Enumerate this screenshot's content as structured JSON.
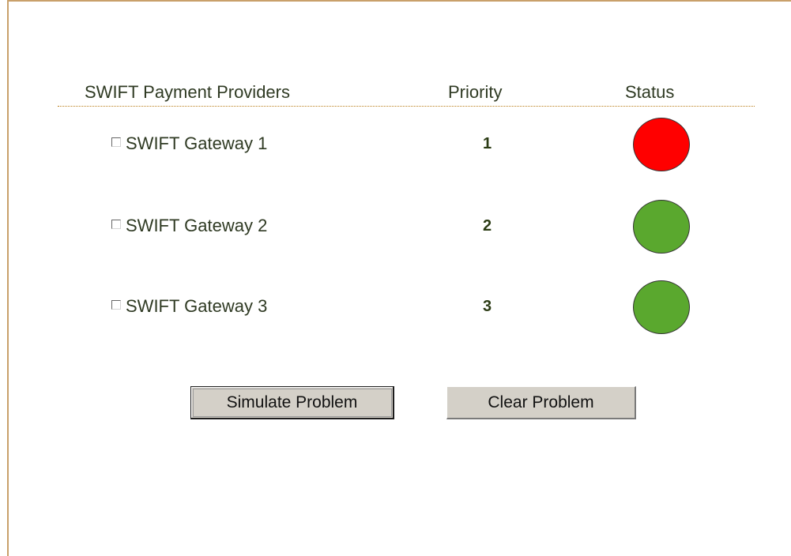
{
  "table": {
    "headers": {
      "provider": "SWIFT Payment Providers",
      "priority": "Priority",
      "status": "Status"
    },
    "rows": [
      {
        "name": "SWIFT Gateway 1",
        "priority": "1",
        "status_color": "#ff0000",
        "checked": false
      },
      {
        "name": "SWIFT Gateway 2",
        "priority": "2",
        "status_color": "#5aa82e",
        "checked": false
      },
      {
        "name": "SWIFT Gateway 3",
        "priority": "3",
        "status_color": "#5aa82e",
        "checked": false
      }
    ]
  },
  "actions": {
    "simulate": "Simulate Problem",
    "clear": "Clear Problem"
  },
  "colors": {
    "border": "#c9a06a",
    "divider": "#b97d18",
    "text": "#2f3a23",
    "priority_text": "#2b3b14",
    "button_bg": "#d4d0c8"
  }
}
